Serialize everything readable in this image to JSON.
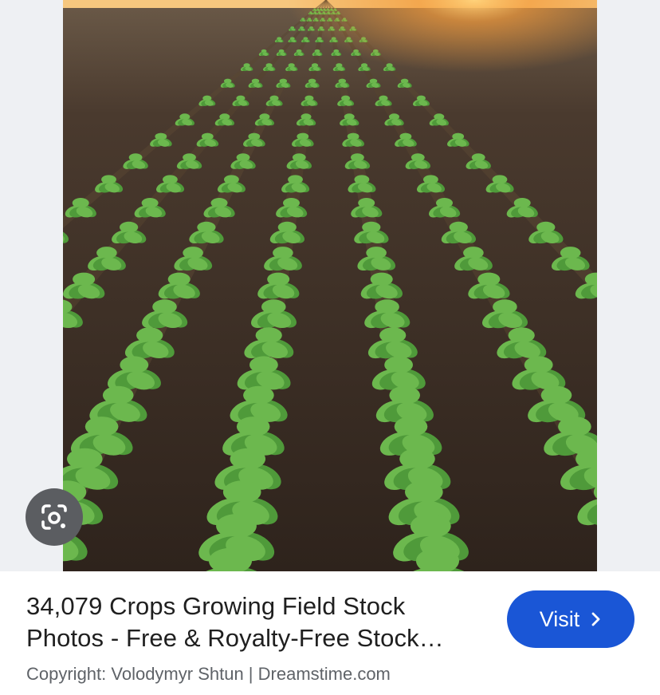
{
  "image": {
    "subject": "rows-of-young-crop-seedlings-at-sunset"
  },
  "lens": {
    "icon": "google-lens-icon"
  },
  "result": {
    "title_line1": "34,079 Crops Growing Field Stock",
    "title_line2": "Photos - Free & Royalty-Free Stock…",
    "copyright": "Copyright: Volodymyr Shtun | Dreamstime.com"
  },
  "visit": {
    "label": "Visit",
    "icon": "chevron-right-icon"
  },
  "colors": {
    "visit_button": "#1a56d6",
    "lens_button": "#5b5d61",
    "title_text": "#1f1f1f",
    "secondary_text": "#5f6368",
    "viewer_background": "#eef0f3"
  }
}
